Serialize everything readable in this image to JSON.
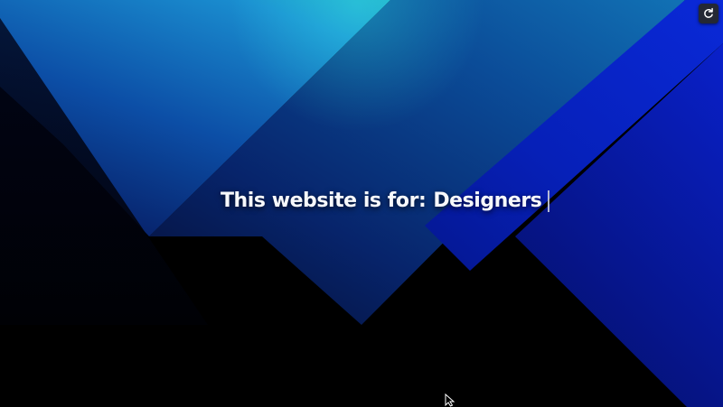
{
  "page": {
    "background": "#000000",
    "accent_colors": {
      "teal": "#27e3b4",
      "cyan": "#1a8ed0",
      "blue": "#0a29d8",
      "deep_navy": "#06175c"
    }
  },
  "hero": {
    "prefix": "This website is for:",
    "typed_word": "Designers"
  },
  "toolbar": {
    "refresh_icon": "refresh-icon"
  },
  "cursor": {
    "icon": "mouse-pointer-icon"
  }
}
